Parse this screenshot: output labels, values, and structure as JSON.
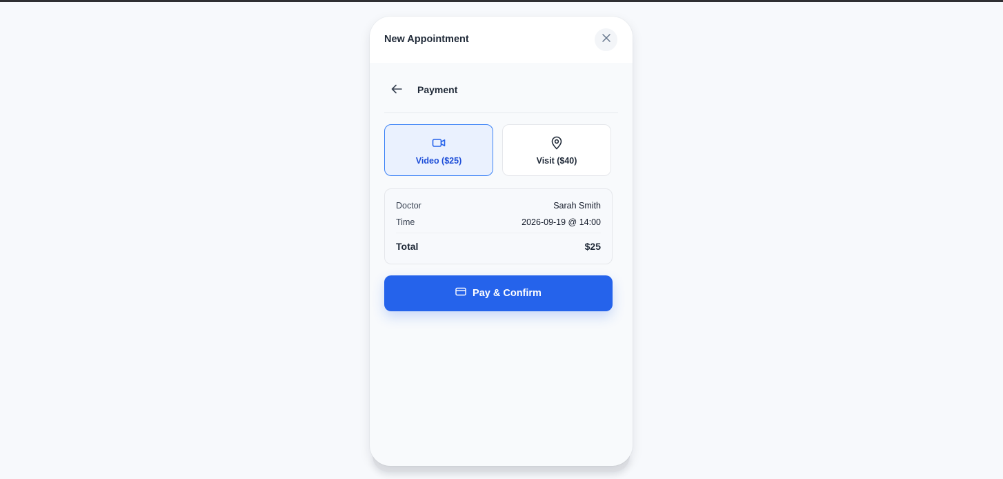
{
  "modal": {
    "title": "New Appointment"
  },
  "section": {
    "title": "Payment"
  },
  "options": [
    {
      "label": "Video ($25)",
      "icon": "video-camera-icon",
      "selected": true
    },
    {
      "label": "Visit ($40)",
      "icon": "map-pin-icon",
      "selected": false
    }
  ],
  "summary": {
    "doctor_label": "Doctor",
    "doctor_value": "Sarah Smith",
    "time_label": "Time",
    "time_value": "2026-09-19 @ 14:00",
    "total_label": "Total",
    "total_value": "$25"
  },
  "pay_button": {
    "label": "Pay & Confirm",
    "icon": "credit-card-icon"
  },
  "colors": {
    "accent": "#2563eb",
    "selected_bg": "#eaf1fe",
    "selected_border": "#3b82f6"
  }
}
